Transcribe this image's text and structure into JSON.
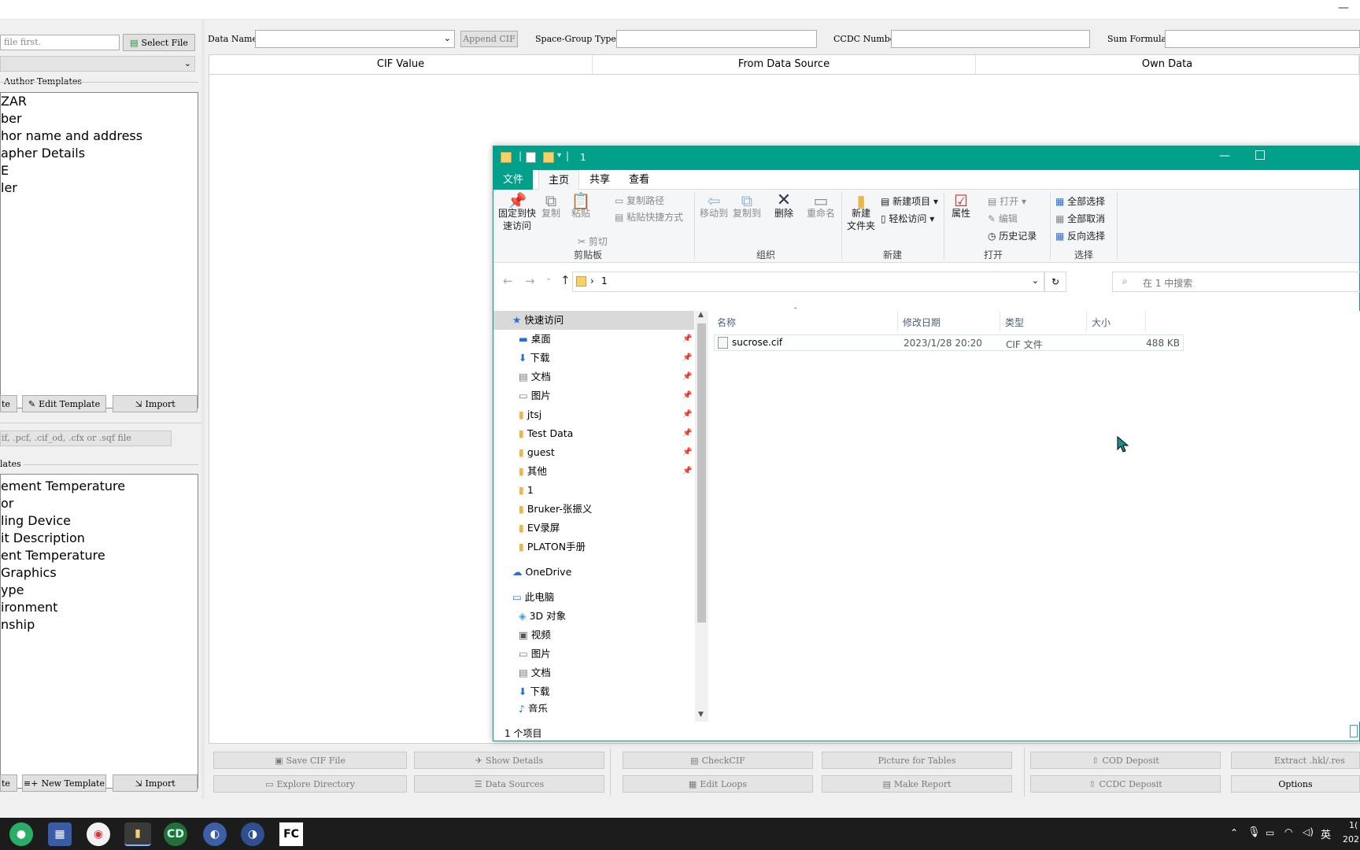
{
  "left_panel": {
    "file_input_placeholder": "file first.",
    "select_file_button": "Select File",
    "author_templates_label": "Author Templates",
    "author_list": [
      "ZAR",
      "ber",
      "hor name and address",
      "apher Details",
      "E",
      "ler"
    ],
    "btn_partial_1": "te",
    "edit_template_button": "Edit Template",
    "import_button": "Import",
    "file_types_hint": "if, .pcf, .cif_od, .cfx or .sqf file",
    "templates_label": "lates",
    "templates_list": [
      "ement Temperature",
      "or",
      "ling Device",
      "it Description",
      "ent Temperature",
      "Graphics",
      "ype",
      "ironment",
      "nship"
    ],
    "btn_partial_2": "te",
    "new_template_button": "New Template",
    "import_button_2": "Import"
  },
  "top_row": {
    "data_name_label": "Data Name",
    "data_name_value": "",
    "append_cif_button": "Append CIF",
    "space_group_label": "Space-Group Type",
    "ccdc_label": "CCDC Number",
    "sum_formula_label": "Sum Formula"
  },
  "grid_headers": [
    "CIF Value",
    "From Data Source",
    "Own Data"
  ],
  "explorer": {
    "title": "1",
    "tabs": [
      "文件",
      "主页",
      "共享",
      "查看"
    ],
    "ribbon": {
      "pin": "固定到快\n速访问",
      "copy": "复制",
      "paste": "粘贴",
      "copy_path": "复制路径",
      "paste_shortcut": "粘贴快捷方式",
      "cut": "剪切",
      "group_clipboard": "剪贴板",
      "move_to": "移动到",
      "copy_to": "复制到",
      "delete": "删除",
      "rename": "重命名",
      "group_organize": "组织",
      "new_folder": "新建\n文件夹",
      "new_item": "新建项目",
      "easy_access": "轻松访问",
      "group_new": "新建",
      "properties": "属性",
      "open": "打开",
      "edit": "编辑",
      "history": "历史记录",
      "group_open": "打开",
      "select_all": "全部选择",
      "select_none": "全部取消",
      "invert_selection": "反向选择",
      "group_select": "选择"
    },
    "address_path": "1",
    "search_placeholder": "在 1 中搜索",
    "nav": {
      "quick_access": "快速访问",
      "pinned": [
        "桌面",
        "下载",
        "文档",
        "图片",
        "jtsj",
        "Test Data",
        "guest",
        "其他"
      ],
      "unpinned": [
        "1",
        "Bruker-张振义",
        "EV录屏",
        "PLATON手册"
      ],
      "onedrive": "OneDrive",
      "this_pc": "此电脑",
      "pc_items": [
        "3D 对象",
        "视频",
        "图片",
        "文档",
        "下载",
        "音乐"
      ]
    },
    "columns": [
      "名称",
      "修改日期",
      "类型",
      "大小"
    ],
    "files": [
      {
        "name": "sucrose.cif",
        "date": "2023/1/28 20:20",
        "type": "CIF 文件",
        "size": "488 KB"
      }
    ],
    "status": "1 个项目"
  },
  "bottom_buttons": {
    "row1": [
      "Save CIF File",
      "Show Details",
      "CheckCIF",
      "Picture for Tables",
      "COD Deposit",
      "Extract .hkl/.res"
    ],
    "row2": [
      "Explore Directory",
      "Data Sources",
      "Edit Loops",
      "Make Report",
      "CCDC Deposit",
      "Options"
    ]
  },
  "taskbar": {
    "tray_lang": "英",
    "clock_partial_top": "1(",
    "clock_partial_bottom": "202"
  },
  "colors": {
    "explorer_accent": "#00a08a",
    "taskbar": "#1c1c1c"
  }
}
